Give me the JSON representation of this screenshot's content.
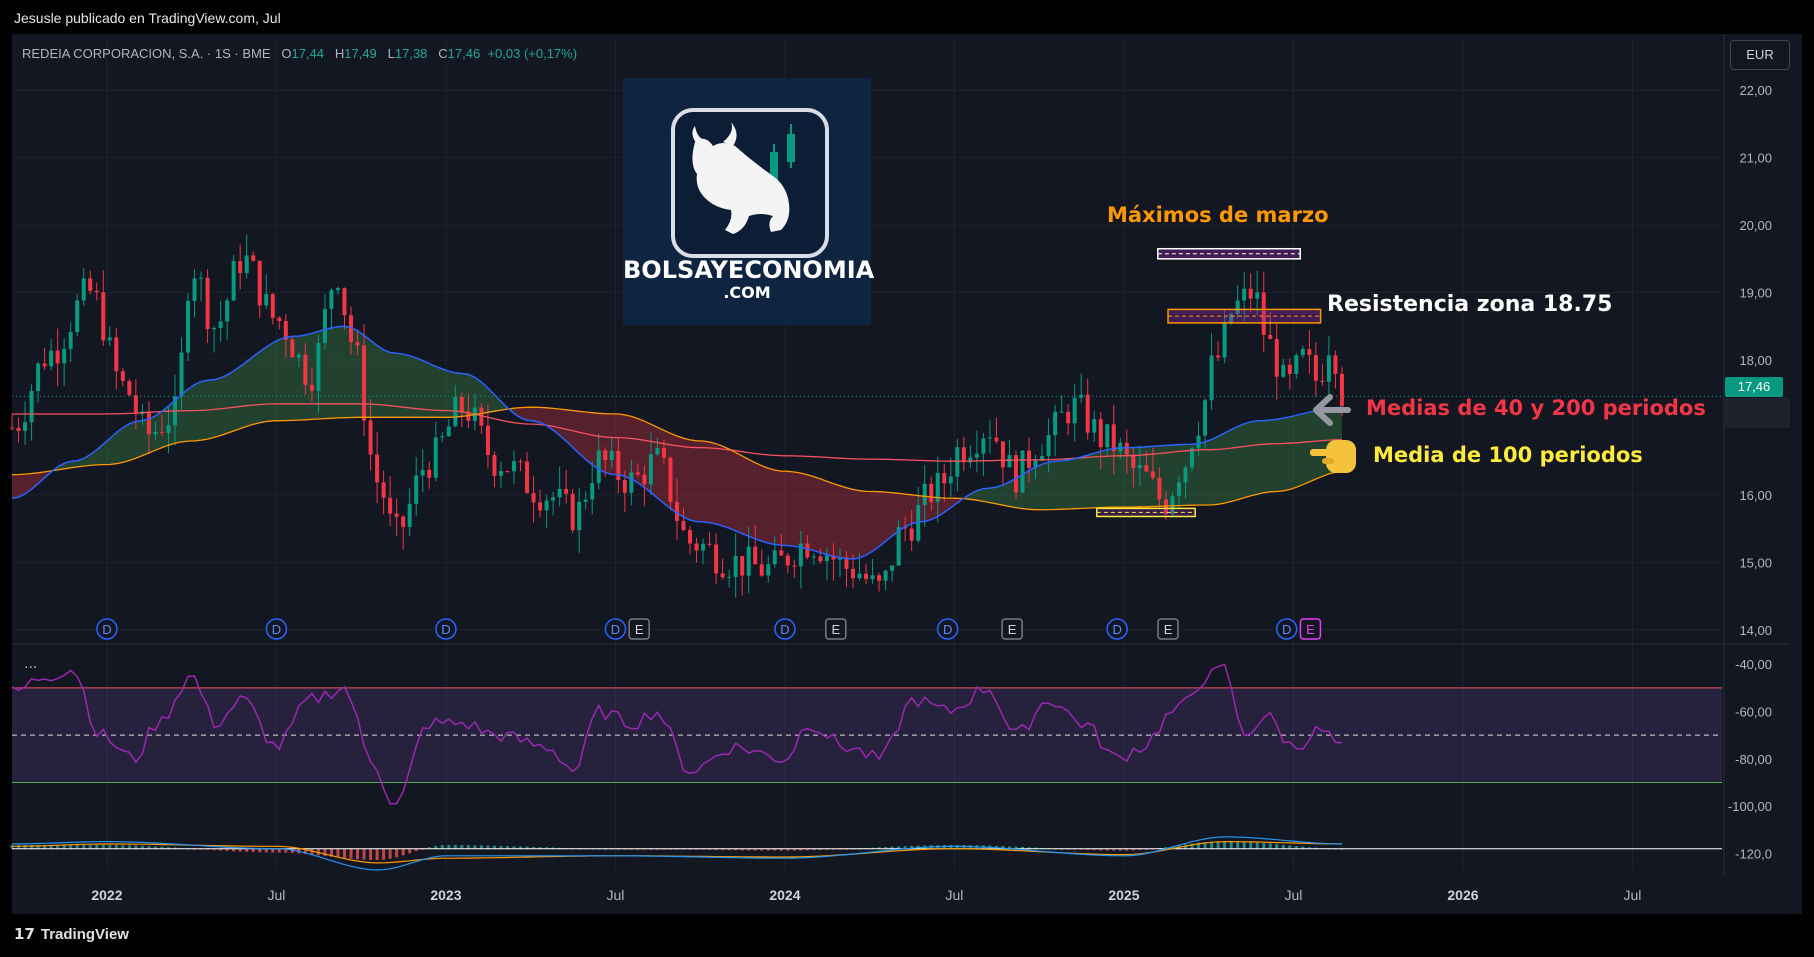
{
  "header": {
    "published": "Jesusle publicado en TradingView.com, Jul"
  },
  "legend": {
    "symbol": "REDEIA CORPORACION, S.A. · 1S · BME",
    "open_label": "O",
    "open": "17,44",
    "high_label": "H",
    "high": "17,49",
    "low_label": "L",
    "low": "17,38",
    "close_label": "C",
    "close": "17,46",
    "change": "+0,03 (+0,17%)"
  },
  "currency": "EUR",
  "last_price": "17,46",
  "brand": {
    "name": "BOLSAYECONOMIA",
    "sub": ".COM"
  },
  "annotations": {
    "maximos": "Máximos de marzo",
    "resistencia": "Resistencia zona 18.75",
    "medias": "Medias de 40 y 200 periodos",
    "media100": "Media de 100 periodos"
  },
  "footer": {
    "brand": "TradingView",
    "logo_glyph": "17"
  },
  "oscillator": {
    "menu": "..."
  },
  "colors": {
    "up": "#089981",
    "down": "#f23645",
    "ma40": "#2962ff",
    "ma100": "#ff9800",
    "ma200": "#f7525f",
    "rsi": "#9c27b0",
    "maximos": "#ff9800",
    "medias": "#f23645",
    "media100": "#ffeb3b",
    "resistencia": "#ffffff"
  },
  "chart_data": {
    "type": "candlestick",
    "interval": "1W",
    "x_ticks": [
      "2022",
      "Jul",
      "2023",
      "Jul",
      "2024",
      "Jul",
      "2025",
      "Jul",
      "2026",
      "Jul"
    ],
    "x_tick_years": [
      2022.0,
      2022.5,
      2023.0,
      2023.5,
      2024.0,
      2024.5,
      2025.0,
      2025.5,
      2026.0,
      2026.5
    ],
    "x_range": [
      2021.72,
      2026.77
    ],
    "price_ticks": [
      "22,00",
      "21,00",
      "20,00",
      "19,00",
      "18,00",
      "16,00",
      "15,00",
      "14,00"
    ],
    "price_tick_values": [
      22,
      21,
      20,
      19,
      18,
      16,
      15,
      14
    ],
    "ylim": [
      13.7,
      22.3
    ],
    "close_keypoints": [
      [
        2021.72,
        17.0
      ],
      [
        2021.83,
        18.1
      ],
      [
        2021.95,
        19.0
      ],
      [
        2022.05,
        17.6
      ],
      [
        2022.12,
        16.9
      ],
      [
        2022.2,
        17.2
      ],
      [
        2022.25,
        19.4
      ],
      [
        2022.32,
        18.5
      ],
      [
        2022.4,
        19.5
      ],
      [
        2022.5,
        18.6
      ],
      [
        2022.6,
        17.8
      ],
      [
        2022.68,
        19.3
      ],
      [
        2022.72,
        18.3
      ],
      [
        2022.8,
        16.2
      ],
      [
        2022.85,
        15.4
      ],
      [
        2022.95,
        16.5
      ],
      [
        2023.05,
        17.3
      ],
      [
        2023.15,
        16.5
      ],
      [
        2023.3,
        16.0
      ],
      [
        2023.38,
        15.7
      ],
      [
        2023.45,
        16.5
      ],
      [
        2023.55,
        16.2
      ],
      [
        2023.62,
        16.5
      ],
      [
        2023.72,
        15.3
      ],
      [
        2023.85,
        15.0
      ],
      [
        2023.95,
        14.9
      ],
      [
        2024.07,
        15.3
      ],
      [
        2024.2,
        14.9
      ],
      [
        2024.28,
        14.6
      ],
      [
        2024.35,
        15.5
      ],
      [
        2024.45,
        16.1
      ],
      [
        2024.52,
        16.7
      ],
      [
        2024.6,
        17.0
      ],
      [
        2024.68,
        16.3
      ],
      [
        2024.76,
        16.8
      ],
      [
        2024.85,
        17.3
      ],
      [
        2024.95,
        16.8
      ],
      [
        2025.05,
        16.3
      ],
      [
        2025.12,
        15.9
      ],
      [
        2025.17,
        16.4
      ],
      [
        2025.22,
        17.1
      ],
      [
        2025.27,
        18.0
      ],
      [
        2025.33,
        18.8
      ],
      [
        2025.38,
        19.0
      ],
      [
        2025.43,
        18.2
      ],
      [
        2025.48,
        17.6
      ],
      [
        2025.53,
        18.0
      ],
      [
        2025.57,
        17.7
      ],
      [
        2025.61,
        18.3
      ],
      [
        2025.65,
        17.46
      ]
    ],
    "ma40_keypoints": [
      [
        2021.72,
        15.95
      ],
      [
        2021.9,
        16.5
      ],
      [
        2022.1,
        17.1
      ],
      [
        2022.3,
        17.7
      ],
      [
        2022.55,
        18.35
      ],
      [
        2022.7,
        18.5
      ],
      [
        2022.85,
        18.1
      ],
      [
        2023.05,
        17.8
      ],
      [
        2023.25,
        17.1
      ],
      [
        2023.5,
        16.3
      ],
      [
        2023.75,
        15.6
      ],
      [
        2024.0,
        15.25
      ],
      [
        2024.2,
        15.05
      ],
      [
        2024.4,
        15.6
      ],
      [
        2024.6,
        16.1
      ],
      [
        2024.8,
        16.5
      ],
      [
        2025.0,
        16.7
      ],
      [
        2025.2,
        16.75
      ],
      [
        2025.4,
        17.1
      ],
      [
        2025.65,
        17.3
      ]
    ],
    "ma100_keypoints": [
      [
        2021.72,
        16.3
      ],
      [
        2022.0,
        16.45
      ],
      [
        2022.25,
        16.8
      ],
      [
        2022.5,
        17.1
      ],
      [
        2022.75,
        17.15
      ],
      [
        2023.0,
        17.15
      ],
      [
        2023.25,
        17.3
      ],
      [
        2023.5,
        17.2
      ],
      [
        2023.75,
        16.8
      ],
      [
        2024.0,
        16.35
      ],
      [
        2024.25,
        16.05
      ],
      [
        2024.5,
        15.95
      ],
      [
        2024.75,
        15.78
      ],
      [
        2025.0,
        15.82
      ],
      [
        2025.25,
        15.85
      ],
      [
        2025.45,
        16.05
      ],
      [
        2025.65,
        16.35
      ]
    ],
    "ma200_keypoints": [
      [
        2021.72,
        17.2
      ],
      [
        2022.0,
        17.2
      ],
      [
        2022.25,
        17.25
      ],
      [
        2022.5,
        17.35
      ],
      [
        2022.75,
        17.35
      ],
      [
        2023.0,
        17.25
      ],
      [
        2023.25,
        17.05
      ],
      [
        2023.5,
        16.85
      ],
      [
        2023.75,
        16.7
      ],
      [
        2024.0,
        16.58
      ],
      [
        2024.25,
        16.53
      ],
      [
        2024.5,
        16.5
      ],
      [
        2024.75,
        16.52
      ],
      [
        2025.0,
        16.58
      ],
      [
        2025.25,
        16.67
      ],
      [
        2025.45,
        16.76
      ],
      [
        2025.65,
        16.82
      ]
    ],
    "events": {
      "dividends_D": [
        2022.0,
        2022.5,
        2023.0,
        2023.5,
        2024.0,
        2024.48,
        2024.98,
        2025.48
      ],
      "earnings_E": [
        2023.57,
        2024.15,
        2024.67,
        2025.13,
        2025.55
      ]
    },
    "zones": [
      {
        "label": "maximos",
        "x": [
          2025.1,
          2025.52
        ],
        "price": [
          19.5,
          19.65
        ]
      },
      {
        "label": "resistencia",
        "x": [
          2025.13,
          2025.58
        ],
        "price": [
          18.55,
          18.75
        ]
      },
      {
        "label": "soporte",
        "x": [
          2024.92,
          2025.21
        ],
        "price": [
          15.68,
          15.8
        ]
      }
    ],
    "oscillator": {
      "name": "RSI",
      "ticks": [
        "-40,00",
        "-60,00",
        "-80,00",
        "-100,00",
        "-120,0"
      ],
      "tick_values": [
        -40,
        -60,
        -80,
        -100,
        -120
      ],
      "ylim": [
        -127,
        -34
      ],
      "band": [
        -50,
        -90
      ],
      "mid": -70,
      "keypoints": [
        [
          2021.72,
          -52
        ],
        [
          2021.82,
          -45
        ],
        [
          2021.9,
          -42
        ],
        [
          2021.98,
          -70
        ],
        [
          2022.08,
          -80
        ],
        [
          2022.15,
          -65
        ],
        [
          2022.25,
          -45
        ],
        [
          2022.32,
          -65
        ],
        [
          2022.4,
          -55
        ],
        [
          2022.5,
          -75
        ],
        [
          2022.6,
          -55
        ],
        [
          2022.7,
          -50
        ],
        [
          2022.78,
          -80
        ],
        [
          2022.85,
          -100
        ],
        [
          2022.95,
          -65
        ],
        [
          2023.05,
          -65
        ],
        [
          2023.15,
          -70
        ],
        [
          2023.3,
          -75
        ],
        [
          2023.38,
          -85
        ],
        [
          2023.45,
          -60
        ],
        [
          2023.55,
          -65
        ],
        [
          2023.62,
          -60
        ],
        [
          2023.72,
          -85
        ],
        [
          2023.85,
          -75
        ],
        [
          2024.0,
          -80
        ],
        [
          2024.07,
          -65
        ],
        [
          2024.18,
          -75
        ],
        [
          2024.28,
          -80
        ],
        [
          2024.38,
          -55
        ],
        [
          2024.48,
          -60
        ],
        [
          2024.6,
          -50
        ],
        [
          2024.68,
          -70
        ],
        [
          2024.78,
          -55
        ],
        [
          2024.88,
          -65
        ],
        [
          2024.98,
          -80
        ],
        [
          2025.05,
          -75
        ],
        [
          2025.15,
          -60
        ],
        [
          2025.25,
          -45
        ],
        [
          2025.3,
          -42
        ],
        [
          2025.35,
          -70
        ],
        [
          2025.42,
          -62
        ],
        [
          2025.5,
          -75
        ],
        [
          2025.58,
          -68
        ],
        [
          2025.65,
          -76
        ]
      ]
    },
    "macd": {
      "macd_keypoints": [
        [
          2021.72,
          -116
        ],
        [
          2022.0,
          -115
        ],
        [
          2022.5,
          -118
        ],
        [
          2022.8,
          -127
        ],
        [
          2023.0,
          -121
        ],
        [
          2023.5,
          -121
        ],
        [
          2024.0,
          -122
        ],
        [
          2024.5,
          -117
        ],
        [
          2025.0,
          -121
        ],
        [
          2025.3,
          -113
        ],
        [
          2025.65,
          -116
        ]
      ],
      "signal_keypoints": [
        [
          2021.72,
          -117
        ],
        [
          2022.0,
          -116
        ],
        [
          2022.5,
          -117
        ],
        [
          2022.8,
          -124
        ],
        [
          2023.0,
          -122
        ],
        [
          2023.5,
          -121
        ],
        [
          2024.0,
          -121.5
        ],
        [
          2024.5,
          -118
        ],
        [
          2025.0,
          -120.5
        ],
        [
          2025.3,
          -115
        ],
        [
          2025.65,
          -116
        ]
      ]
    }
  }
}
